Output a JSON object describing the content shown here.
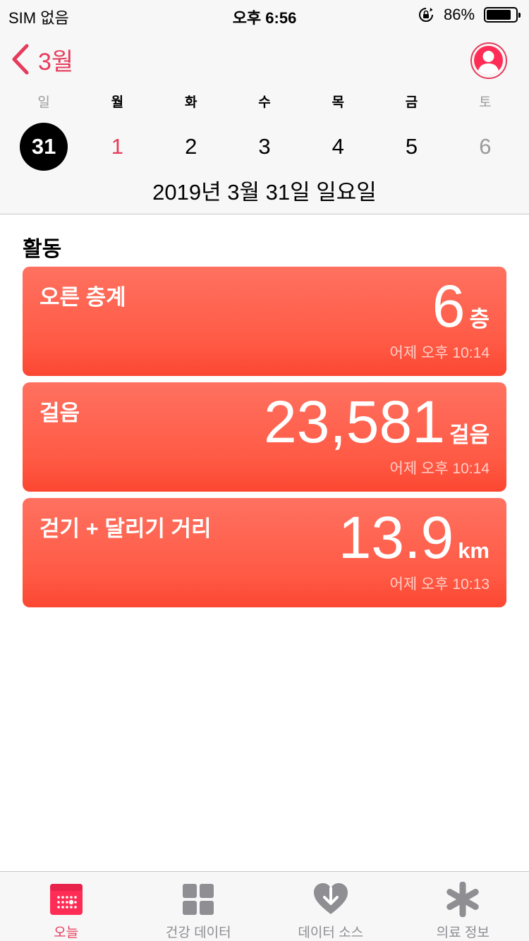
{
  "status_bar": {
    "carrier": "SIM 없음",
    "time": "오후 6:56",
    "battery_percent": "86%",
    "battery_level": 0.86
  },
  "nav": {
    "back_label": "3월"
  },
  "week": {
    "weekdays": [
      "일",
      "월",
      "화",
      "수",
      "목",
      "금",
      "토"
    ],
    "dates": [
      "31",
      "1",
      "2",
      "3",
      "4",
      "5",
      "6"
    ],
    "selected_index": 0,
    "full_date": "2019년 3월 31일 일요일"
  },
  "section": {
    "title": "활동"
  },
  "cards": [
    {
      "label": "오른 층계",
      "value": "6",
      "unit": "층",
      "time": "어제 오후 10:14"
    },
    {
      "label": "걸음",
      "value": "23,581",
      "unit": "걸음",
      "time": "어제 오후 10:14"
    },
    {
      "label": "걷기 + 달리기 거리",
      "value": "13.9",
      "unit": "km",
      "time": "어제 오후 10:13"
    }
  ],
  "tabs": [
    {
      "label": "오늘",
      "icon": "today-calendar-icon",
      "active": true
    },
    {
      "label": "건강 데이터",
      "icon": "health-data-grid-icon",
      "active": false
    },
    {
      "label": "데이터 소스",
      "icon": "sources-heart-download-icon",
      "active": false
    },
    {
      "label": "의료 정보",
      "icon": "medical-id-asterisk-icon",
      "active": false
    }
  ],
  "colors": {
    "accent": "#e63b5b",
    "card": "#ff5a45",
    "inactive": "#8e8e93"
  }
}
